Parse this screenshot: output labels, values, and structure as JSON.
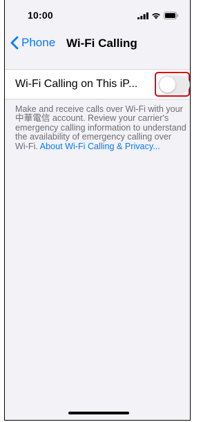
{
  "status_bar": {
    "time": "10:00",
    "icons": [
      "signal-bars-icon",
      "wifi-icon",
      "battery-icon"
    ]
  },
  "nav": {
    "back_label": "Phone",
    "title": "Wi-Fi Calling",
    "back_icon": "chevron-left-icon"
  },
  "setting": {
    "label": "Wi-Fi Calling on This iP...",
    "toggle_state": "off"
  },
  "description": {
    "text": "Make and receive calls over Wi-Fi with your 中華電信 account. Review your carrier's emergency calling information to understand the availability of emergency calling over Wi-Fi. ",
    "link": "About Wi-Fi Calling & Privacy..."
  },
  "colors": {
    "accent": "#0a7aff",
    "background": "#f2f2f7",
    "highlight": "#e0000e"
  }
}
